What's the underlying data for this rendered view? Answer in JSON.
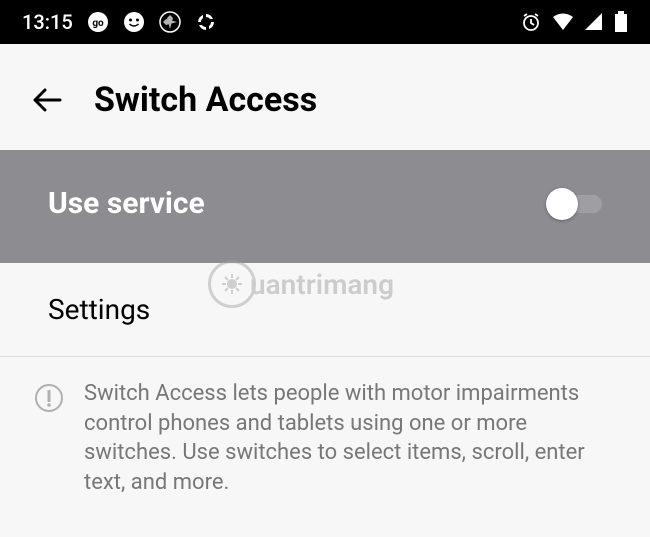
{
  "statusBar": {
    "time": "13:15"
  },
  "header": {
    "title": "Switch Access"
  },
  "useService": {
    "label": "Use service",
    "enabled": false
  },
  "settings": {
    "label": "Settings"
  },
  "info": {
    "text": "Switch Access lets people with motor impairments control phones and tablets using one or more switches. Use switches to select items, scroll, enter text, and more."
  },
  "watermark": {
    "text": "uantrimang"
  }
}
